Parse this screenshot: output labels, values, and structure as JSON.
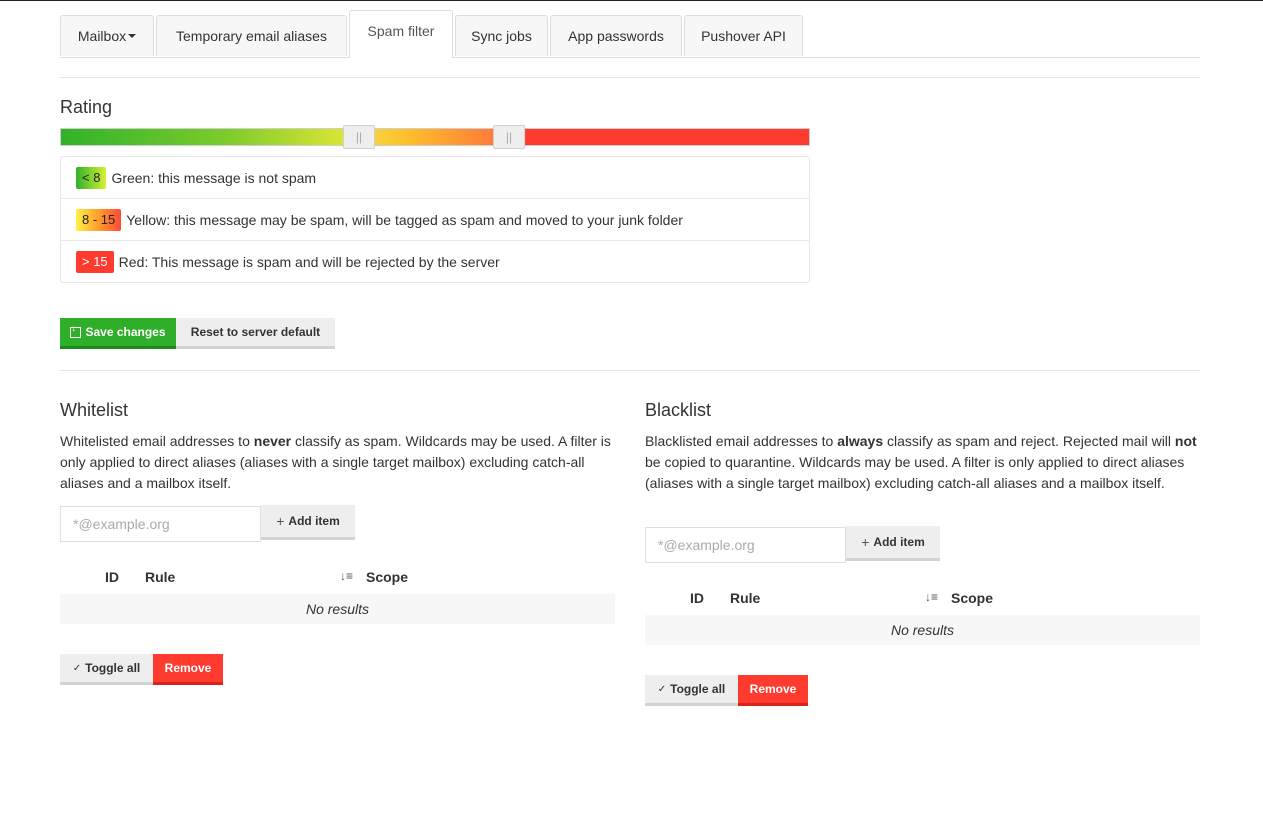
{
  "tabs": [
    {
      "label": "Mailbox",
      "has_caret": true
    },
    {
      "label": "Temporary email aliases"
    },
    {
      "label": "Spam filter",
      "active": true
    },
    {
      "label": "Sync jobs"
    },
    {
      "label": "App passwords"
    },
    {
      "label": "Pushover API"
    }
  ],
  "rating": {
    "title": "Rating",
    "low_threshold": 8,
    "high_threshold": 15,
    "legend": [
      {
        "badge": "< 8",
        "text": "Green: this message is not spam",
        "color": "#31b22a"
      },
      {
        "badge": "8 - 15",
        "text": "Yellow: this message may be spam, will be tagged as spam and moved to your junk folder",
        "color": "#ffd23a"
      },
      {
        "badge": "> 15",
        "text": "Red: This message is spam and will be rejected by the server",
        "color": "#ff3b30"
      }
    ],
    "save_label": "Save changes",
    "reset_label": "Reset to server default"
  },
  "whitelist": {
    "title": "Whitelist",
    "desc_pre": "Whitelisted email addresses to ",
    "desc_bold": "never",
    "desc_post": " classify as spam. Wildcards may be used. A filter is only applied to direct aliases (aliases with a single target mailbox) excluding catch-all aliases and a mailbox itself.",
    "placeholder": "*@example.org",
    "add_label": "Add item",
    "col_id": "ID",
    "col_rule": "Rule",
    "col_scope": "Scope",
    "empty": "No results",
    "toggle_label": "Toggle all",
    "remove_label": "Remove"
  },
  "blacklist": {
    "title": "Blacklist",
    "desc_pre": "Blacklisted email addresses to ",
    "desc_bold": "always",
    "desc_mid": " classify as spam and reject. Rejected mail will ",
    "desc_bold2": "not",
    "desc_post": " be copied to quarantine. Wildcards may be used. A filter is only applied to direct aliases (aliases with a single target mailbox) excluding catch-all aliases and a mailbox itself.",
    "placeholder": "*@example.org",
    "add_label": "Add item",
    "col_id": "ID",
    "col_rule": "Rule",
    "col_scope": "Scope",
    "empty": "No results",
    "toggle_label": "Toggle all",
    "remove_label": "Remove"
  },
  "colors": {
    "success": "#2fae2a",
    "danger": "#ff3b30"
  }
}
